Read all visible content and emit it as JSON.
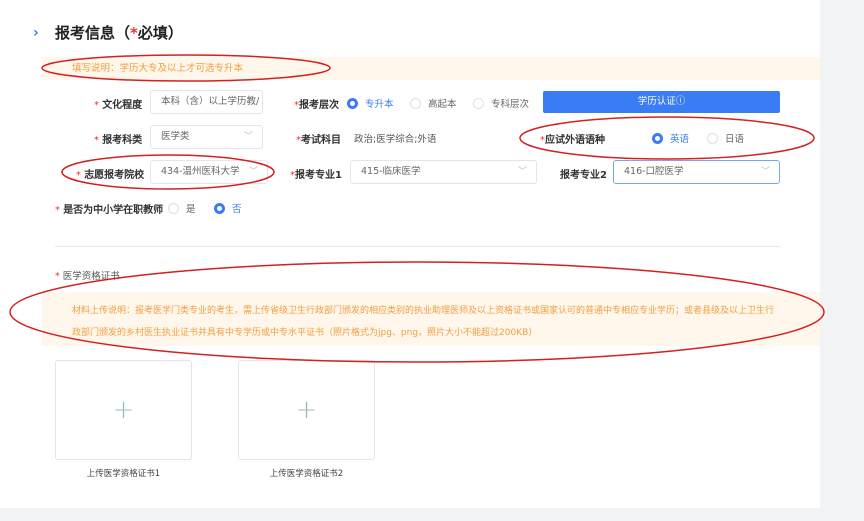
{
  "section": {
    "title_prefix": "报考信息（",
    "required_mark": "*",
    "title_suffix": "必填）"
  },
  "notice_top": "填写说明：学历大专及以上才可选专升本",
  "fields": {
    "education": {
      "label": "文化程度",
      "value": "本科（含）以上学历教/"
    },
    "level": {
      "label": "报考层次",
      "options": [
        "专升本",
        "高起本",
        "专科层次"
      ],
      "selected": "专升本"
    },
    "verify_button": "学历认证ⓘ",
    "category": {
      "label": "报考科类",
      "value": "医学类"
    },
    "subjects": {
      "label": "考试科目",
      "value": "政治;医学综合;外语"
    },
    "language": {
      "label": "应试外语语种",
      "options": [
        "英语",
        "日语"
      ],
      "selected": "英语"
    },
    "school": {
      "label": "志愿报考院校",
      "value": "434-温州医科大学"
    },
    "major1": {
      "label": "报考专业1",
      "value": "415-临床医学"
    },
    "major2": {
      "label": "报考专业2",
      "value": "416-口腔医学"
    },
    "teacher": {
      "label": "是否为中小学在职教师",
      "options": [
        "是",
        "否"
      ],
      "selected": "否"
    }
  },
  "certificate": {
    "label": "医学资格证书",
    "notice_line1": "材料上传说明：报考医学门类专业的考生，需上传省级卫生行政部门颁发的相应类别的执业助理医师及以上资格证书或国家认可的普通中专相应专业学历；或者县级及以上卫生行",
    "notice_line2": "政部门颁发的乡村医生执业证书并具有中专学历或中专水平证书（照片格式为jpg、png，照片大小不能超过200KB）",
    "uploads": [
      "上传医学资格证书1",
      "上传医学资格证书2"
    ]
  },
  "colors": {
    "accent": "#3a7cf4",
    "notice_text": "#f0a040",
    "notice_bg": "#fff6ec",
    "required": "#e33333",
    "annotation": "#d42020"
  }
}
